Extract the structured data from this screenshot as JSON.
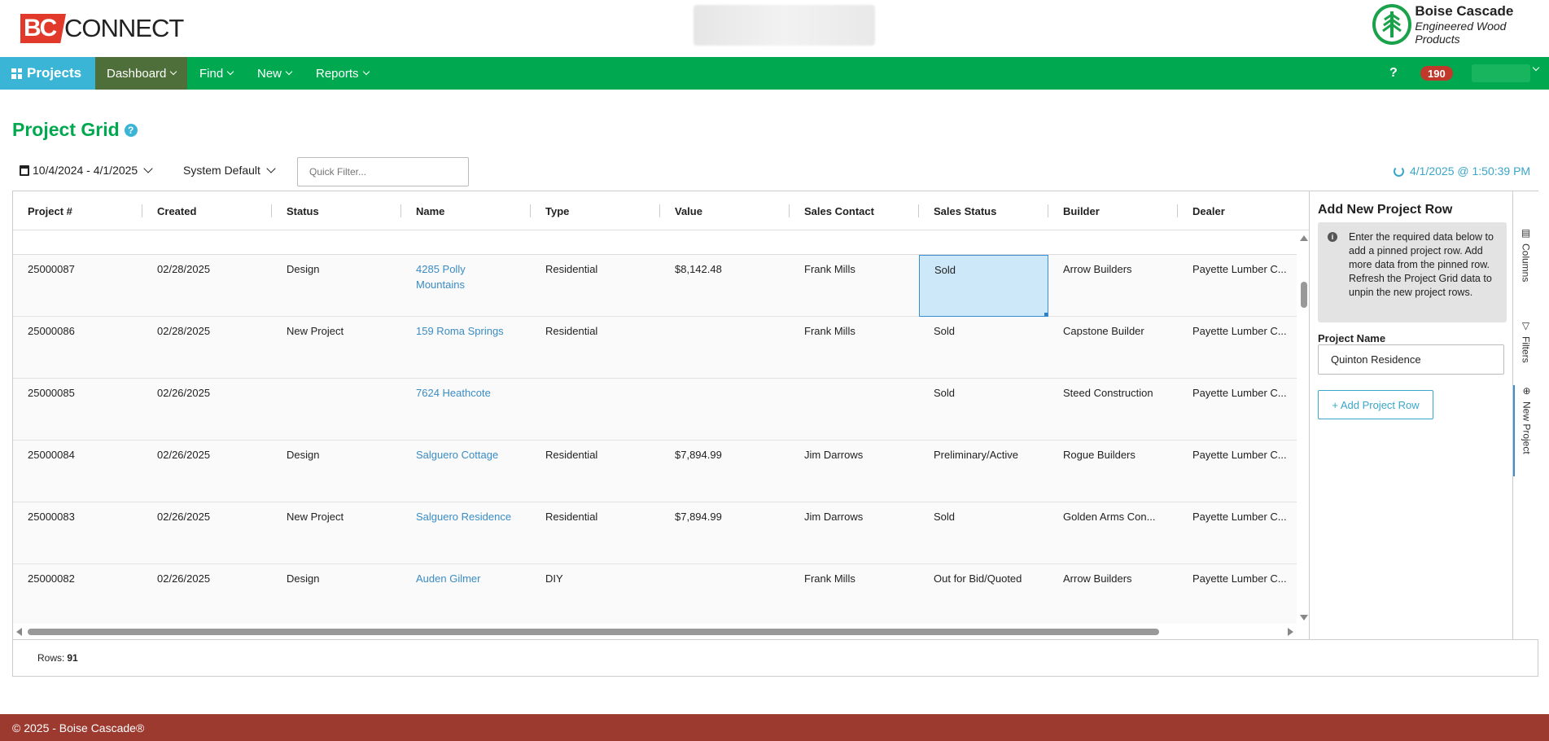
{
  "header": {
    "logo_bc": "BC",
    "logo_connect": "CONNECT",
    "brand_name": "Boise Cascade",
    "brand_tagline": "Engineered Wood Products"
  },
  "nav": {
    "projects": "Projects",
    "dashboard": "Dashboard",
    "find": "Find",
    "new": "New",
    "reports": "Reports",
    "help": "?",
    "badge_count": "190"
  },
  "page": {
    "title": "Project Grid",
    "help": "?"
  },
  "toolbar": {
    "date_range": "10/4/2024 - 4/1/2025",
    "view": "System Default",
    "quick_filter_placeholder": "Quick Filter...",
    "refresh_timestamp": "4/1/2025 @ 1:50:39 PM"
  },
  "grid": {
    "columns": [
      "Project #",
      "Created",
      "Status",
      "Name",
      "Type",
      "Value",
      "Sales Contact",
      "Sales Status",
      "Builder",
      "Dealer"
    ],
    "rows": [
      [
        "25000087",
        "02/28/2025",
        "Design",
        "4285 Polly Mountains",
        "Residential",
        "$8,142.48",
        "Frank Mills",
        "Sold",
        "Arrow Builders",
        "Payette Lumber C..."
      ],
      [
        "25000086",
        "02/28/2025",
        "New Project",
        "159 Roma Springs",
        "Residential",
        "",
        "Frank Mills",
        "Sold",
        "Capstone Builder",
        "Payette Lumber C..."
      ],
      [
        "25000085",
        "02/26/2025",
        "",
        "7624 Heathcote",
        "",
        "",
        "",
        "Sold",
        "Steed Construction",
        "Payette Lumber C..."
      ],
      [
        "25000084",
        "02/26/2025",
        "Design",
        "Salguero Cottage",
        "Residential",
        "$7,894.99",
        "Jim Darrows",
        "Preliminary/Active",
        "Rogue Builders",
        "Payette Lumber C..."
      ],
      [
        "25000083",
        "02/26/2025",
        "New Project",
        "Salguero Residence",
        "Residential",
        "$7,894.99",
        "Jim Darrows",
        "Sold",
        "Golden Arms Con...",
        "Payette Lumber C..."
      ],
      [
        "25000082",
        "02/26/2025",
        "Design",
        "Auden Gilmer",
        "DIY",
        "",
        "Frank Mills",
        "Out for Bid/Quoted",
        "Arrow Builders",
        "Payette Lumber C..."
      ]
    ],
    "rows_label": "Rows:",
    "rows_count": "91"
  },
  "side_panel": {
    "title": "Add New Project Row",
    "info": "Enter the required data below to add a pinned project row. Add more data from the pinned row. Refresh the Project Grid data to unpin the new project rows.",
    "field_label": "Project Name",
    "field_value": "Quinton Residence",
    "add_button": "+ Add Project Row",
    "tabs": [
      "Columns",
      "Filters",
      "New Project"
    ]
  },
  "footer": {
    "copyright": "© 2025 - Boise Cascade®"
  },
  "colors": {
    "nav_green": "#00a94f",
    "projects_blue": "#3bb5d6",
    "dashboard_active": "#4e6f3a",
    "footer_red": "#9d3a2f",
    "link_blue": "#3a8cc4"
  }
}
